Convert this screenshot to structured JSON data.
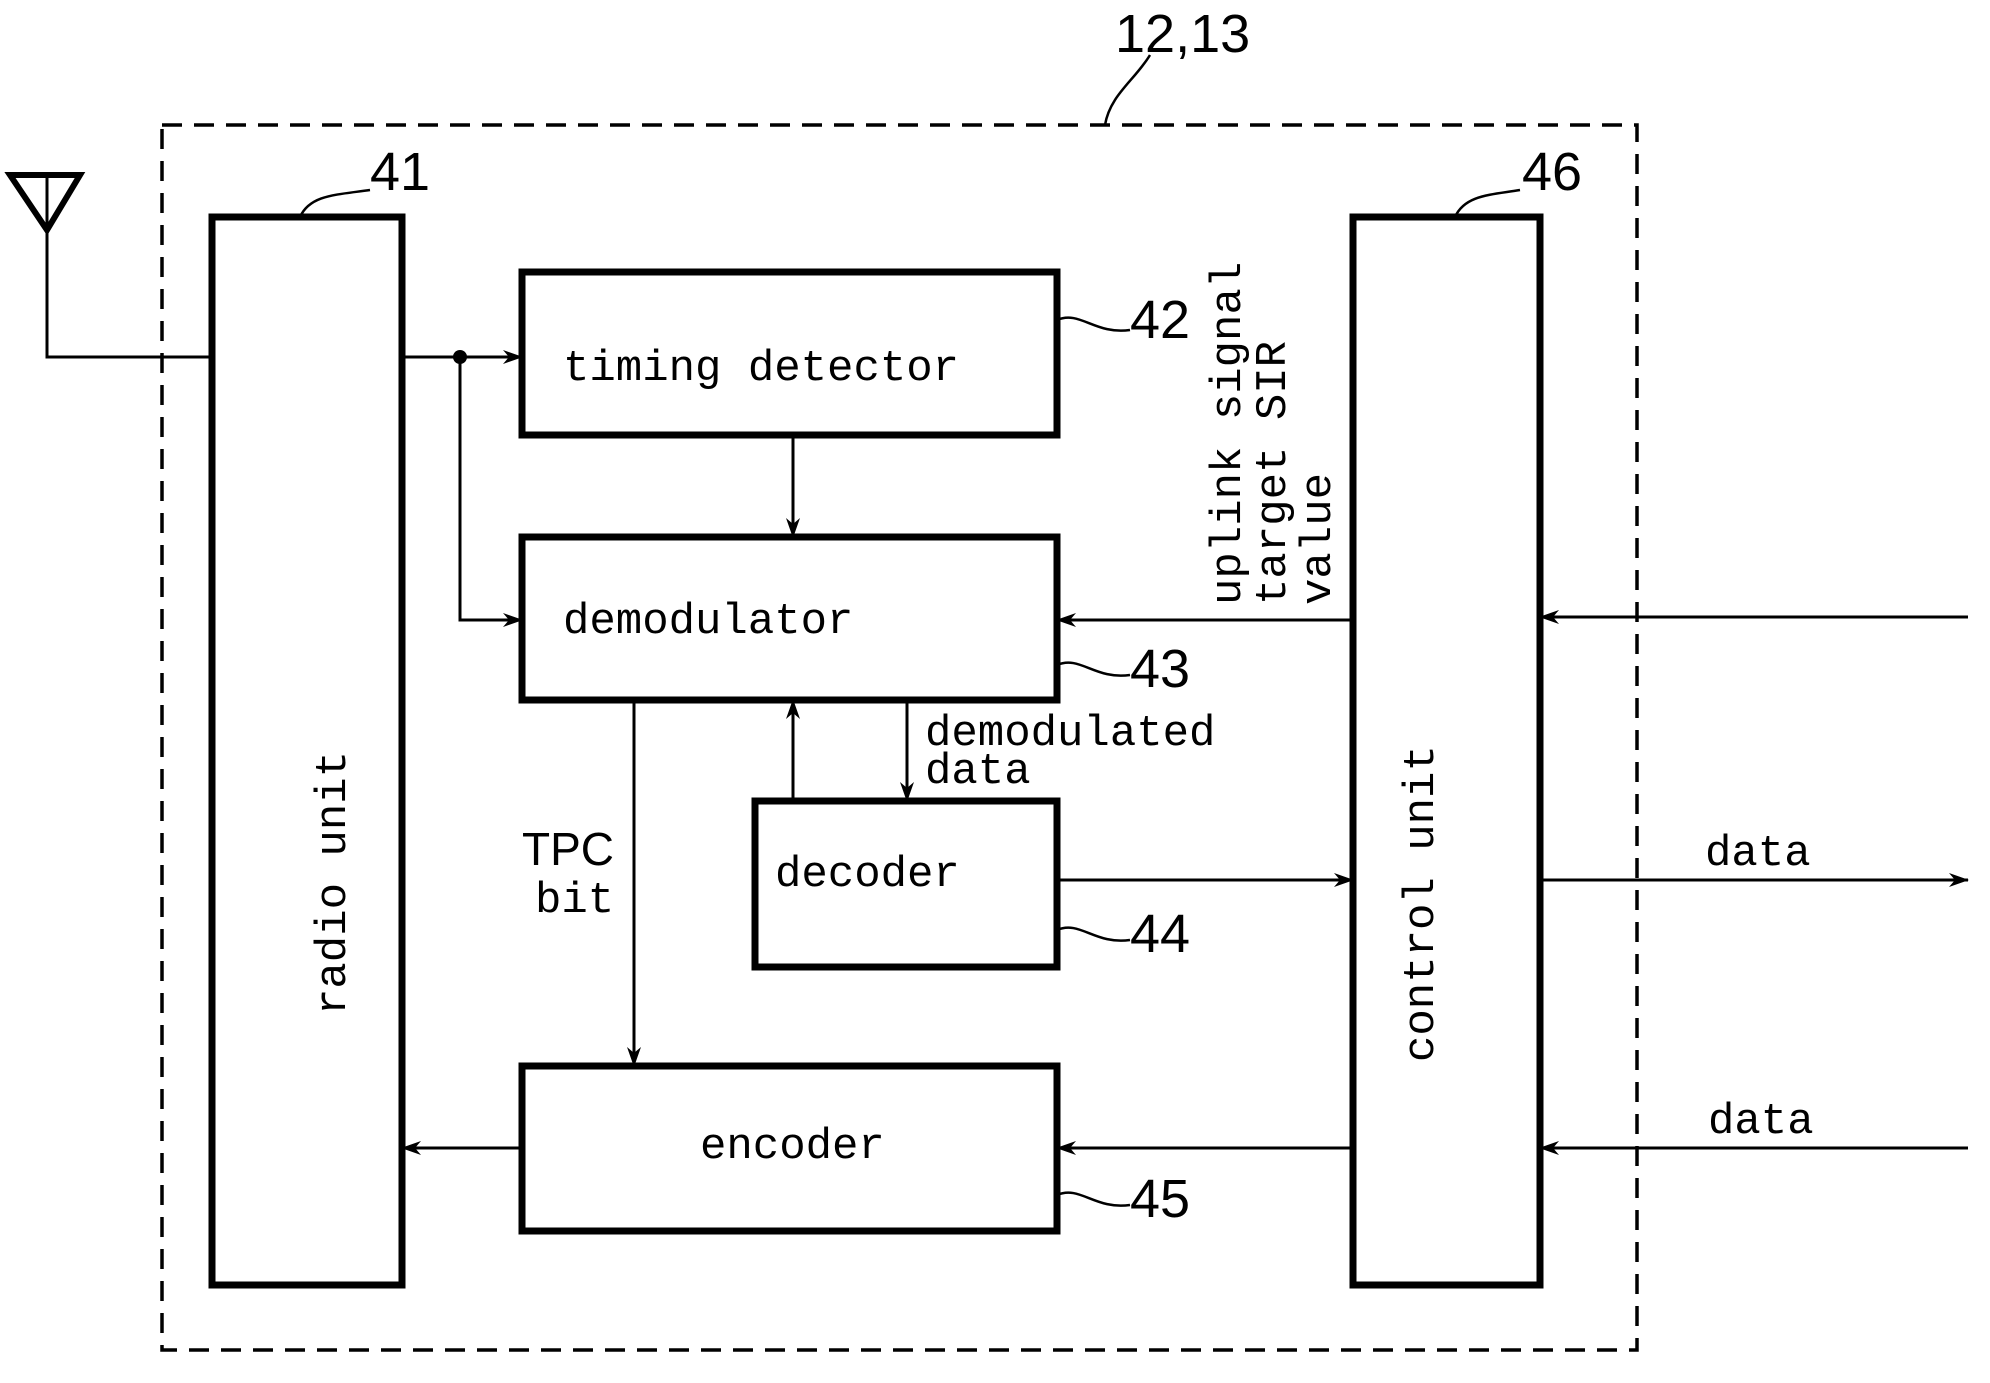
{
  "diagram": {
    "enclosure_ref": "12,13",
    "blocks": {
      "radio_unit": {
        "label": "radio unit",
        "ref": "41"
      },
      "timing_detector": {
        "label": "timing detector",
        "ref": "42"
      },
      "demodulator": {
        "label": "demodulator",
        "ref": "43"
      },
      "decoder": {
        "label": "decoder",
        "ref": "44"
      },
      "encoder": {
        "label": "encoder",
        "ref": "45"
      },
      "control_unit": {
        "label": "control unit",
        "ref": "46"
      }
    },
    "signals": {
      "sir_line1": "uplink signal",
      "sir_line2": "target SIR",
      "sir_line3": "value",
      "demod_data_line1": "demodulated",
      "demod_data_line2": "data",
      "tpc_line1": "TPC",
      "tpc_line2": "bit",
      "data_out": "data",
      "data_in": "data"
    },
    "icons": {
      "antenna": "antenna-icon"
    }
  }
}
